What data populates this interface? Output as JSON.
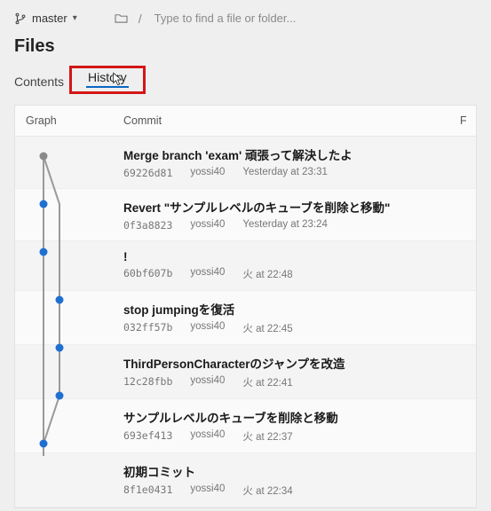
{
  "topbar": {
    "branch_label": "master",
    "breadcrumb_slash": "/",
    "path_placeholder": "Type to find a file or folder..."
  },
  "files_title": "Files",
  "tabs": {
    "contents": "Contents",
    "history": "History"
  },
  "headers": {
    "graph": "Graph",
    "commit": "Commit",
    "right": "F"
  },
  "commits": [
    {
      "title": "Merge branch 'exam' 頑張って解決したよ",
      "hash": "69226d81",
      "author": "yossi40",
      "time": "Yesterday at 23:31"
    },
    {
      "title": "Revert \"サンプルレベルのキューブを削除と移動\"",
      "hash": "0f3a8823",
      "author": "yossi40",
      "time": "Yesterday at 23:24"
    },
    {
      "title": "!",
      "hash": "60bf607b",
      "author": "yossi40",
      "time": "火 at 22:48"
    },
    {
      "title": "stop jumpingを復活",
      "hash": "032ff57b",
      "author": "yossi40",
      "time": "火 at 22:45"
    },
    {
      "title": "ThirdPersonCharacterのジャンプを改造",
      "hash": "12c28fbb",
      "author": "yossi40",
      "time": "火 at 22:41"
    },
    {
      "title": "サンプルレベルのキューブを削除と移動",
      "hash": "693ef413",
      "author": "yossi40",
      "time": "火 at 22:37"
    },
    {
      "title": "初期コミット",
      "hash": "8f1e0431",
      "author": "yossi40",
      "time": "火 at 22:34"
    }
  ]
}
